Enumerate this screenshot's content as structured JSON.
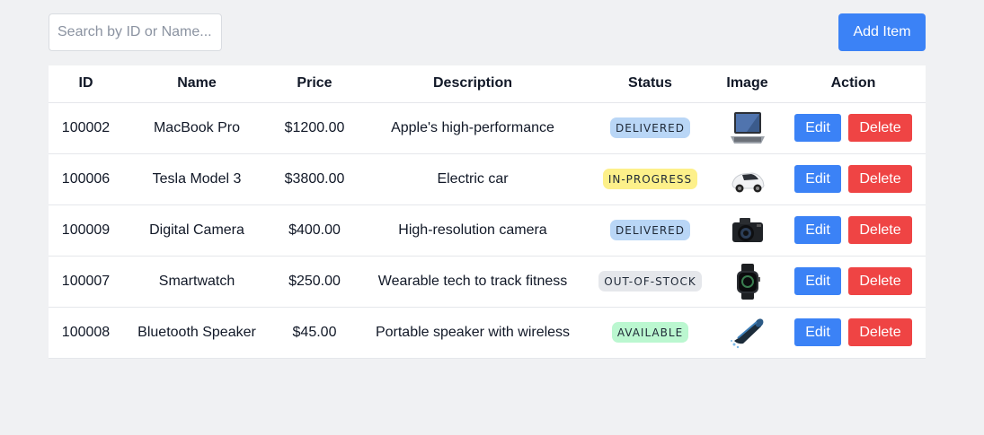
{
  "toolbar": {
    "search_placeholder": "Search by ID or Name...",
    "add_label": "Add Item"
  },
  "table": {
    "headers": {
      "id": "ID",
      "name": "Name",
      "price": "Price",
      "description": "Description",
      "status": "Status",
      "image": "Image",
      "action": "Action"
    },
    "edit_label": "Edit",
    "delete_label": "Delete",
    "status_colors": {
      "DELIVERED": "#b9d6f6",
      "IN-PROGRESS": "#fdf08a",
      "OUT-OF-STOCK": "#e5e7eb",
      "AVAILABLE": "#bbf7d0"
    },
    "rows": [
      {
        "id": "100002",
        "name": "MacBook Pro",
        "price": "$1200.00",
        "description": "Apple's high-performance",
        "status": "DELIVERED",
        "image": "laptop-image"
      },
      {
        "id": "100006",
        "name": "Tesla Model 3",
        "price": "$3800.00",
        "description": "Electric car",
        "status": "IN-PROGRESS",
        "image": "car-image"
      },
      {
        "id": "100009",
        "name": "Digital Camera",
        "price": "$400.00",
        "description": "High-resolution camera",
        "status": "DELIVERED",
        "image": "camera-image"
      },
      {
        "id": "100007",
        "name": "Smartwatch",
        "price": "$250.00",
        "description": "Wearable tech to track fitness",
        "status": "OUT-OF-STOCK",
        "image": "smartwatch-image"
      },
      {
        "id": "100008",
        "name": "Bluetooth Speaker",
        "price": "$45.00",
        "description": "Portable speaker with wireless",
        "status": "AVAILABLE",
        "image": "speaker-image"
      }
    ]
  }
}
